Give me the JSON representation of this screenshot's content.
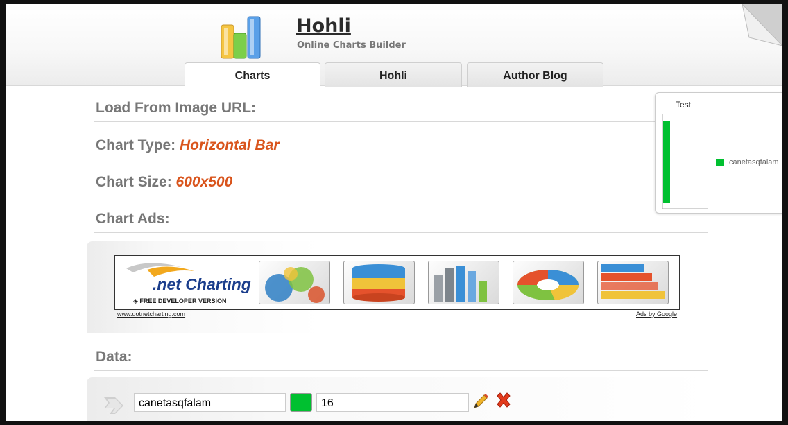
{
  "header": {
    "title": "Hohli",
    "subtitle": "Online Charts Builder"
  },
  "tabs": [
    {
      "label": "Charts",
      "active": true
    },
    {
      "label": "Hohli",
      "active": false
    },
    {
      "label": "Author Blog",
      "active": false
    }
  ],
  "sections": {
    "load_label": "Load From Image URL:",
    "type_label": "Chart Type:",
    "type_value": "Horizontal Bar",
    "size_label": "Chart Size:",
    "size_value": "600x500",
    "ads_label": "Chart Ads:",
    "data_label": "Data:"
  },
  "ad": {
    "brand": ".net Charting",
    "sub": "FREE DEVELOPER VERSION",
    "link_left": "www.dotnetcharting.com",
    "link_right": "Ads by Google"
  },
  "data_row": {
    "name": "canetasqfalam",
    "value": "16",
    "color": "#00c030"
  },
  "preview": {
    "title": "Test",
    "legend": "canetasqfalam",
    "color": "#00c030"
  },
  "chart_data": {
    "type": "bar",
    "title": "Test",
    "categories": [
      "canetasqfalam"
    ],
    "series": [
      {
        "name": "canetasqfalam",
        "values": [
          16
        ]
      }
    ]
  },
  "colors": {
    "accent": "#d9541c",
    "label_gray": "#777777",
    "series_green": "#00c030"
  }
}
